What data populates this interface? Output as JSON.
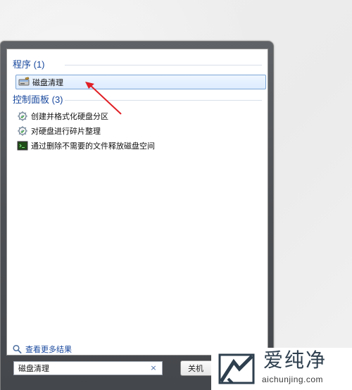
{
  "search_menu": {
    "programs_heading": "程序 (1)",
    "control_panel_heading": "控制面板 (3)",
    "program_results": [
      {
        "label": "磁盘清理",
        "icon": "disk-cleanup-icon"
      }
    ],
    "control_panel_results": [
      {
        "label": "创建并格式化硬盘分区",
        "icon": "gear-icon"
      },
      {
        "label": "对硬盘进行碎片整理",
        "icon": "gear-icon"
      },
      {
        "label": "通过删除不需要的文件释放磁盘空间",
        "icon": "terminal-icon"
      }
    ],
    "see_more": "查看更多结果",
    "search_value": "磁盘清理",
    "clear_label": "×",
    "shutdown_label": "关机"
  },
  "watermark": {
    "title": "爱纯净",
    "url": "aichunjing.com"
  },
  "colors": {
    "accent": "#17479d",
    "selection_border": "#7fa7d6",
    "arrow_red": "#e01f25"
  }
}
